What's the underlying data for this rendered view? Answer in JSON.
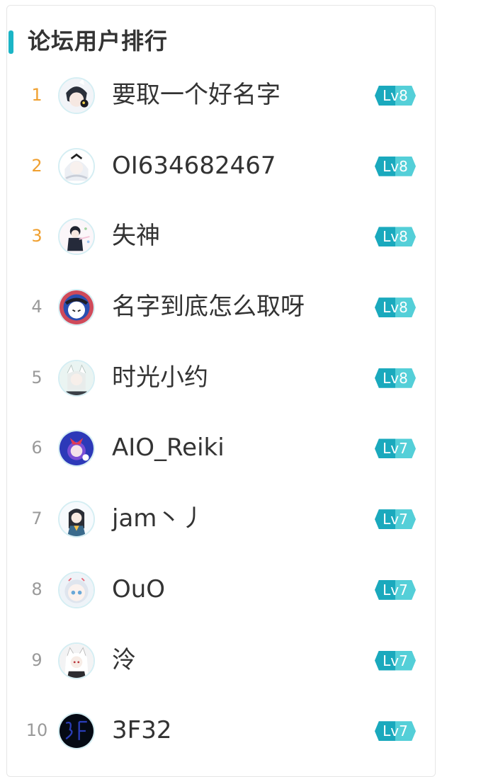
{
  "title": "论坛用户排行",
  "colors": {
    "accent": "#1bb5c6",
    "level_start": "#1aa9bd",
    "level_end": "#54cfd8",
    "top_rank": "#f0a030",
    "rank": "#9a9a9a",
    "text": "#333333"
  },
  "users": [
    {
      "rank": "1",
      "name": "要取一个好名字",
      "level": "Lv8",
      "avatar": "avatar-1"
    },
    {
      "rank": "2",
      "name": "OI634682467",
      "level": "Lv8",
      "avatar": "avatar-2"
    },
    {
      "rank": "3",
      "name": "失神",
      "level": "Lv8",
      "avatar": "avatar-3"
    },
    {
      "rank": "4",
      "name": "名字到底怎么取呀",
      "level": "Lv8",
      "avatar": "avatar-4"
    },
    {
      "rank": "5",
      "name": "时光小约",
      "level": "Lv8",
      "avatar": "avatar-5"
    },
    {
      "rank": "6",
      "name": "AIO_Reiki",
      "level": "Lv7",
      "avatar": "avatar-6"
    },
    {
      "rank": "7",
      "name": "jam丶丿",
      "level": "Lv7",
      "avatar": "avatar-7"
    },
    {
      "rank": "8",
      "name": "OuO",
      "level": "Lv7",
      "avatar": "avatar-8"
    },
    {
      "rank": "9",
      "name": "泠",
      "level": "Lv7",
      "avatar": "avatar-9"
    },
    {
      "rank": "10",
      "name": "3F32",
      "level": "Lv7",
      "avatar": "avatar-10"
    }
  ]
}
